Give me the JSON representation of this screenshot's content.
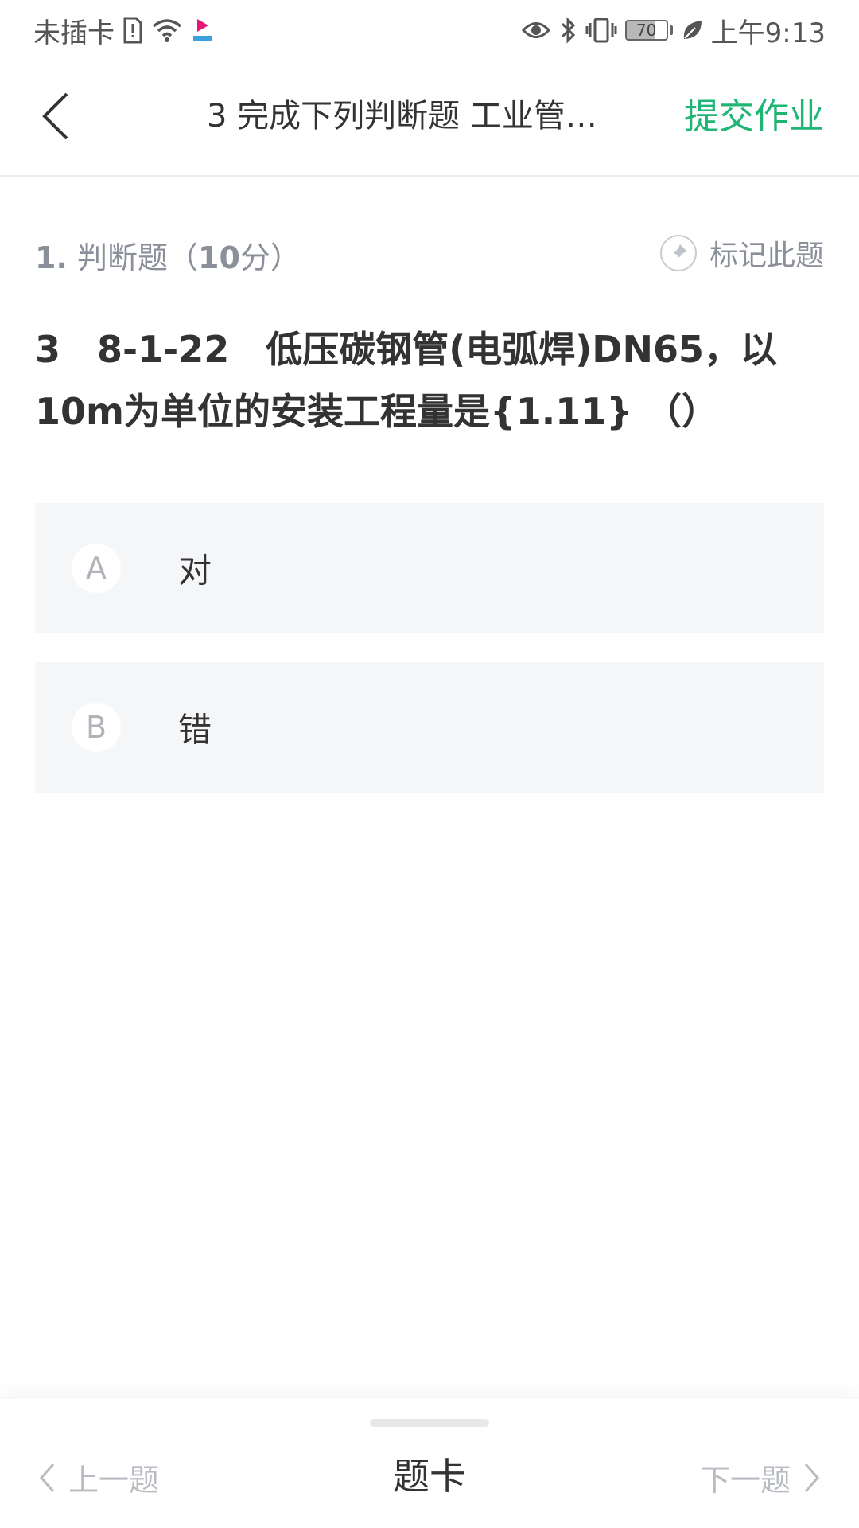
{
  "status_bar": {
    "carrier": "未插卡",
    "battery_level": 70,
    "battery_text": "70",
    "time": "上午9:13"
  },
  "header": {
    "title": "3 完成下列判断题 工业管…",
    "submit_label": "提交作业",
    "accent_color": "#1fb574"
  },
  "question": {
    "number": "1.",
    "type": "判断题（",
    "score": "10",
    "score_suffix": "分）",
    "mark_label": "标记此题",
    "text": "3　8-1-22　低压碳钢管(电弧焊)DN65，以10m为单位的安装工程量是{1.11} （）"
  },
  "options": [
    {
      "letter": "A",
      "text": "对"
    },
    {
      "letter": "B",
      "text": "错"
    }
  ],
  "footer": {
    "prev_label": "上一题",
    "card_label": "题卡",
    "next_label": "下一题"
  }
}
